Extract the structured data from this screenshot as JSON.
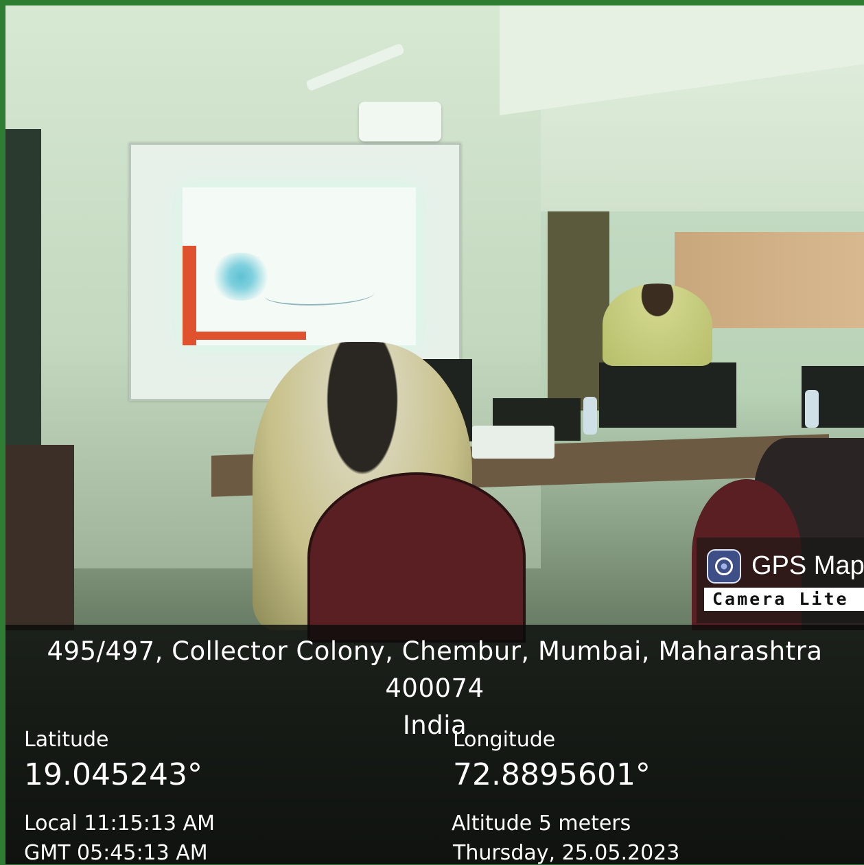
{
  "badge": {
    "title": "GPS Map",
    "subtitle": "Camera Lite",
    "icon": "camera-lens-icon"
  },
  "location": {
    "address_line1": "495/497, Collector Colony, Chembur, Mumbai, Maharashtra 400074",
    "address_line2": "India"
  },
  "coords": {
    "latitude_label": "Latitude",
    "latitude_value": "19.045243°",
    "longitude_label": "Longitude",
    "longitude_value": "72.8895601°"
  },
  "time": {
    "local": "Local 11:15:13 AM",
    "gmt": "GMT 05:45:13 AM"
  },
  "extra": {
    "altitude": "Altitude 5 meters",
    "date": "Thursday, 25.05.2023"
  },
  "colors": {
    "border": "#2e7d32",
    "overlay": "#0a0c0a"
  }
}
